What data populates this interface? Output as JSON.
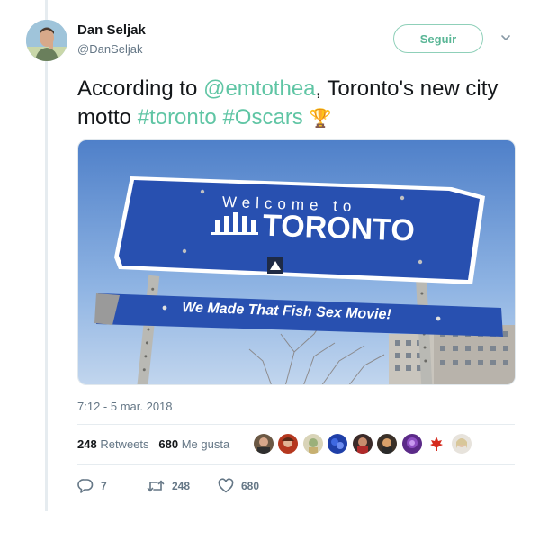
{
  "author": {
    "name": "Dan Seljak",
    "handle": "@DanSeljak"
  },
  "follow_label": "Seguir",
  "tweet": {
    "text_part1": "According to ",
    "mention": "@emtothea",
    "text_part2": ", Toronto's new city motto ",
    "hashtag1": "#toronto",
    "space": " ",
    "hashtag2": "#Oscars",
    "emoji": "🏆"
  },
  "media": {
    "sign_welcome": "Welcome to",
    "sign_city": "TORONTO",
    "sign_motto": "We Made That Fish Sex Movie!"
  },
  "timestamp": "7:12 - 5 mar. 2018",
  "stats": {
    "retweets_count": "248",
    "retweets_label": "Retweets",
    "likes_count": "680",
    "likes_label": "Me gusta"
  },
  "actions": {
    "reply_count": "7",
    "retweet_count": "248",
    "like_count": "680"
  },
  "colors": {
    "accent": "#5fc5a4",
    "muted": "#657786",
    "text": "#14171a",
    "divider": "#e6ecf0"
  },
  "icons": {
    "reply": "reply-icon",
    "retweet": "retweet-icon",
    "like": "heart-icon",
    "more": "chevron-down-icon"
  }
}
